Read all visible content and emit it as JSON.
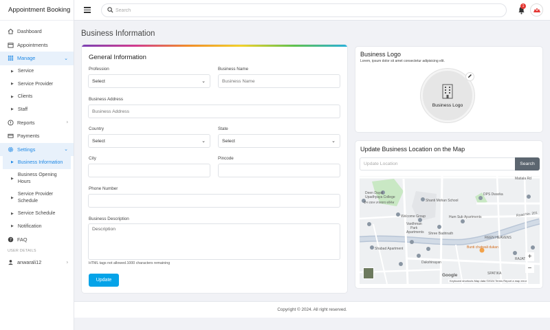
{
  "app": {
    "title": "Appointment Booking"
  },
  "colors": {
    "accent": "#1e88e5",
    "update_button": "#05a3e8",
    "search_button": "#5c6670",
    "badge": "#e53935"
  },
  "sidebar": {
    "dashboard": "Dashboard",
    "appointments": "Appointments",
    "manage": "Manage",
    "manage_items": [
      "Service",
      "Service Provider",
      "Clients",
      "Staff"
    ],
    "reports": "Reports",
    "payments": "Payments",
    "settings": "Settings",
    "settings_items": [
      "Business Information",
      "Business Opening Hours",
      "Service Provider Schedule",
      "Service Schedule",
      "Notification"
    ],
    "faq": "FAQ",
    "user_details_label": "USER DETAILS",
    "username": "anwarali12"
  },
  "topbar": {
    "search_placeholder": "Search",
    "notification_count": "1"
  },
  "page": {
    "title": "Business Information"
  },
  "general": {
    "title": "General Information",
    "profession_label": "Profession",
    "profession_value": "Select",
    "business_name_label": "Business Name",
    "business_name_placeholder": "Business Name",
    "business_address_label": "Business Address",
    "business_address_placeholder": "Business Address",
    "country_label": "Country",
    "country_value": "Select",
    "state_label": "State",
    "state_value": "Select",
    "city_label": "City",
    "pincode_label": "Pincode",
    "phone_label": "Phone Number",
    "description_label": "Business Description",
    "description_placeholder": "Description",
    "hint": "HTML tags not allowed.1000 characters remaining",
    "update_label": "Update"
  },
  "logo": {
    "title": "Business Logo",
    "description": "Lorem, ipsum dolor sit amet consectetur adipisicing elit.",
    "placeholder_label": "Business Logo"
  },
  "location": {
    "title": "Update Business Location on the Map",
    "input_placeholder": "Update Location",
    "search_label": "Search",
    "map_labels": {
      "matiala": "Matiala Rd",
      "deen": "Deen Dayal",
      "upadhyaya": "Upadhyaya College",
      "hindi": "दीन दयाल उपाध्याय कॉलेज",
      "shanti": "Shanti Mohan School",
      "dps": "DPS Dwarka",
      "welcome": "Welcome Group",
      "hum": "Hum Sub Apartments",
      "vardhman": "Vardhman",
      "park": "Park",
      "apartments": "Apartments",
      "shree": "Shree Badrinath",
      "shabad": "Shabad Apartment",
      "reen": "REEN HEAVENS",
      "bunti": "Bunti chatwali dukan",
      "dakshinayan": "Dakshinayan",
      "spatika": "SPATIKA",
      "rajat": "RAJAT",
      "road": "Road No. 201"
    },
    "map_attribution": "Keyboard shortcuts   Map data ©2024   Terms   Report a map error",
    "google": "Google"
  },
  "footer": {
    "copyright": "Copyright © 2024. All right reserved."
  }
}
